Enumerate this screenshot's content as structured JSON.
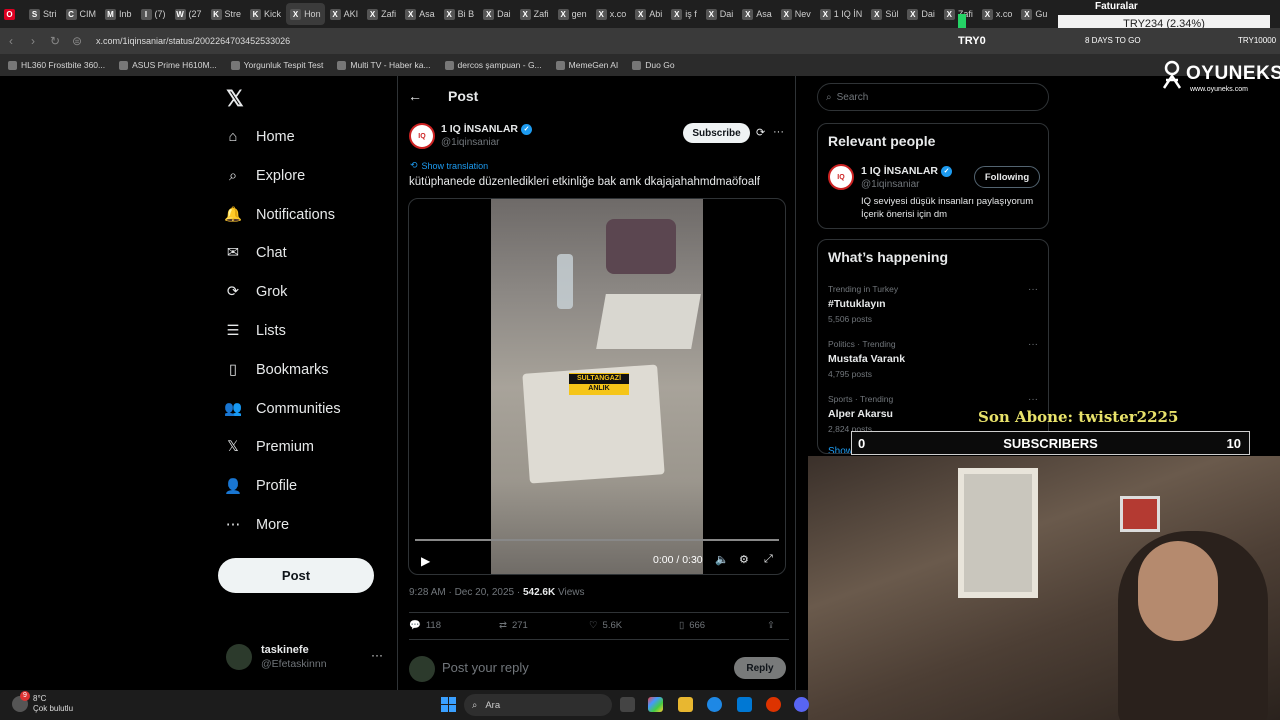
{
  "browser": {
    "tabs": [
      {
        "label": "Stri",
        "icon": "S"
      },
      {
        "label": "CIM",
        "icon": "C"
      },
      {
        "label": "Inb",
        "icon": "M"
      },
      {
        "label": "(7)",
        "icon": "I"
      },
      {
        "label": "(27",
        "icon": "W"
      },
      {
        "label": "Stre",
        "icon": "K"
      },
      {
        "label": "Kick",
        "icon": "K"
      },
      {
        "label": "Hon",
        "icon": "X",
        "active": true
      },
      {
        "label": "AKI",
        "icon": "X"
      },
      {
        "label": "Zafi",
        "icon": "X"
      },
      {
        "label": "Asa",
        "icon": "X"
      },
      {
        "label": "Bi B",
        "icon": "X"
      },
      {
        "label": "Dai",
        "icon": "X"
      },
      {
        "label": "Zafi",
        "icon": "X"
      },
      {
        "label": "gen",
        "icon": "X"
      },
      {
        "label": "x.co",
        "icon": "X"
      },
      {
        "label": "Abi",
        "icon": "X"
      },
      {
        "label": "iş f",
        "icon": "X"
      },
      {
        "label": "Dai",
        "icon": "X"
      },
      {
        "label": "Asa",
        "icon": "X"
      },
      {
        "label": "Nev",
        "icon": "X"
      },
      {
        "label": "1 IQ İN",
        "icon": "X"
      },
      {
        "label": "Sül",
        "icon": "X"
      },
      {
        "label": "Dai",
        "icon": "X"
      },
      {
        "label": "Zafi",
        "icon": "X"
      },
      {
        "label": "x.co",
        "icon": "X"
      },
      {
        "label": "Gu",
        "icon": "X"
      }
    ],
    "url": "x.com/1iqinsaniar/status/2002264703452533026",
    "bookmarks": [
      "HL360 Frostbite 360...",
      "ASUS Prime H610M...",
      "Yorgunluk Tespit Test",
      "Multi TV - Haber ka...",
      "dercos şampuan - G...",
      "MemeGen AI",
      "Duo Go"
    ]
  },
  "overlay": {
    "faturalar": "Faturalar",
    "currency": "TRY234 (2.34%)",
    "try0": "TRY0",
    "days_to_go": "8 DAYS TO GO",
    "try10000": "TRY10000",
    "brand": "OYUNEKS",
    "brand_site": "www.oyuneks.com",
    "last_sub": "Son Abone: twister2225",
    "sub_left": "0",
    "sub_label": "SUBSCRIBERS",
    "sub_right": "10"
  },
  "nav": {
    "items": [
      "Home",
      "Explore",
      "Notifications",
      "Chat",
      "Grok",
      "Lists",
      "Bookmarks",
      "Communities",
      "Premium",
      "Profile",
      "More"
    ],
    "post_button": "Post",
    "account_name": "taskinefe",
    "account_handle": "@Efetaskinnn"
  },
  "post": {
    "header": "Post",
    "author_name": "1 IQ İNSANLAR",
    "author_handle": "@1iqinsaniar",
    "subscribe": "Subscribe",
    "show_translation": "Show translation",
    "text": "kütüphanede düzenledikleri etkinliğe bak amk dkajajahahmdmaöfoalf",
    "sticker_line1": "SULTANGAZİ",
    "sticker_line2": "ANLIK",
    "video_time": "0:00 / 0:30",
    "timestamp": "9:28 AM · Dec 20, 2025 · ",
    "views_count": "542.6K",
    "views_label": " Views",
    "replies": "118",
    "reposts": "271",
    "likes": "5.6K",
    "bookmarks": "666",
    "reply_placeholder": "Post your reply",
    "reply_button": "Reply"
  },
  "sidebar": {
    "search_placeholder": "Search",
    "relevant_title": "Relevant people",
    "rp_name": "1 IQ İNSANLAR",
    "rp_handle": "@1iqinsaniar",
    "rp_follow": "Following",
    "rp_bio": "IQ seviyesi düşük insanları paylaşıyorum İçerik önerisi için dm",
    "happening_title": "What’s happening",
    "trends": [
      {
        "context": "Trending in Turkey",
        "title": "#Tutuklayın",
        "count": "5,506 posts"
      },
      {
        "context": "Politics · Trending",
        "title": "Mustafa Varank",
        "count": "4,795 posts"
      },
      {
        "context": "Sports · Trending",
        "title": "Alper Akarsu",
        "count": "2,824 posts"
      }
    ],
    "show_more": "Show more"
  },
  "taskbar": {
    "temp": "8°C",
    "weather": "Çok bulutlu",
    "badge": "9",
    "search": "Ara"
  },
  "colors": {
    "accent": "#1d9bf0",
    "background": "#000000",
    "border": "#2f3336",
    "muted": "#71767b"
  }
}
